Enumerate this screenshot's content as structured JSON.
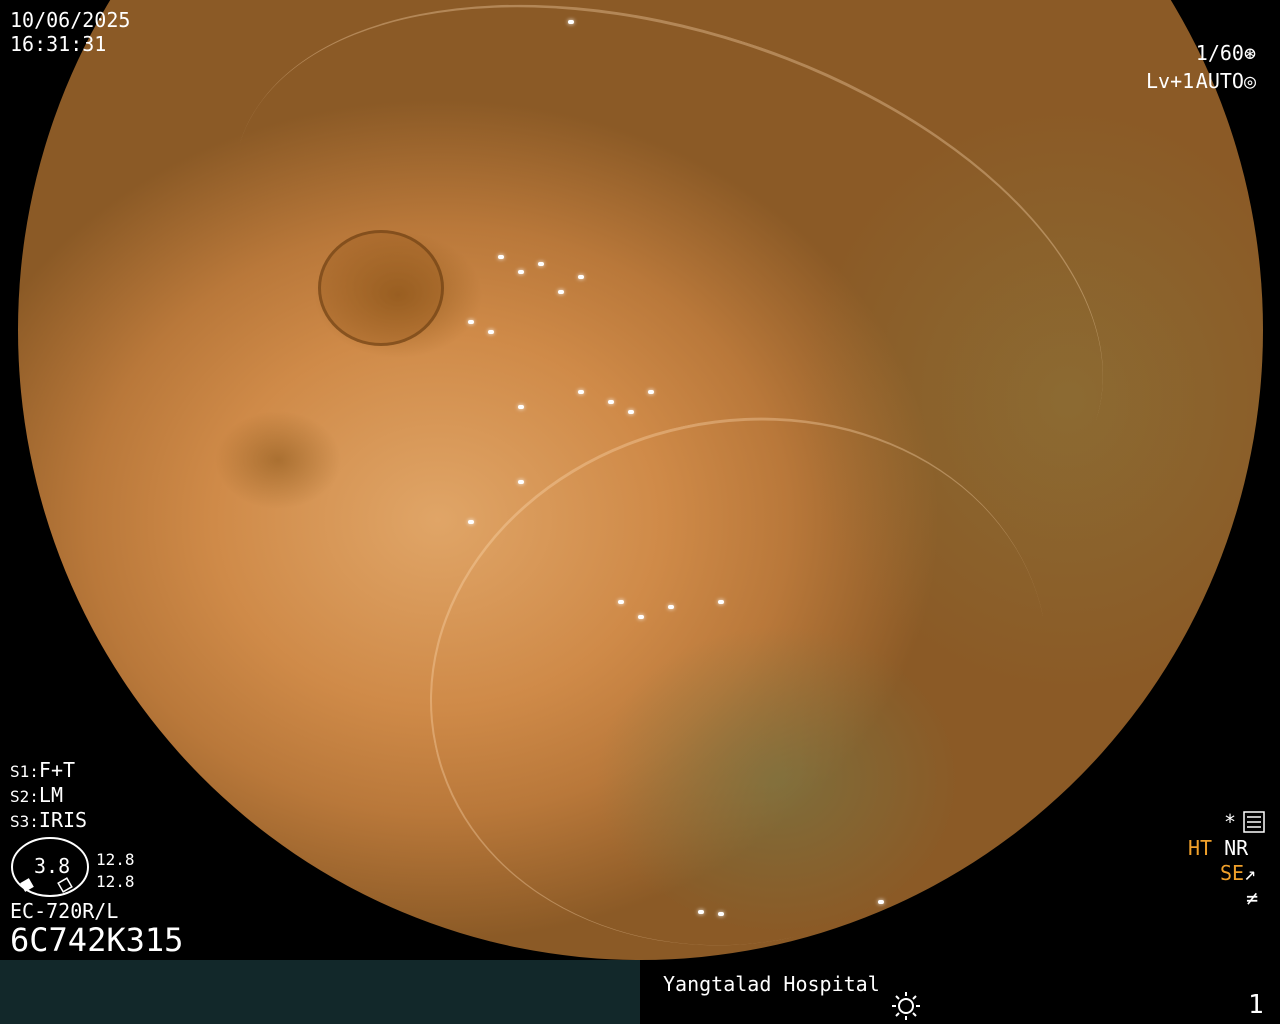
{
  "header": {
    "date": "10/06/2025",
    "time": "16:31:31"
  },
  "exposure": {
    "shutter": "1/60",
    "level": "Lv+1",
    "mode": "AUTO"
  },
  "settings": {
    "s1_label": "S1:",
    "s1_value": "F+T",
    "s2_label": "S2:",
    "s2_value": "LM",
    "s3_label": "S3:",
    "s3_value": "IRIS"
  },
  "gauge": {
    "value": "3.8",
    "upper": "12.8",
    "lower": "12.8"
  },
  "scope": {
    "model": "EC-720R/L",
    "serial": "6C742K315"
  },
  "status": {
    "asterisk": "*",
    "ht": "HT",
    "nr": "NR",
    "se": "SE"
  },
  "footer": {
    "hospital": "Yangtalad Hospital",
    "page": "1"
  },
  "colors": {
    "accent": "#f0a02a",
    "footer_bg": "#12282a"
  }
}
